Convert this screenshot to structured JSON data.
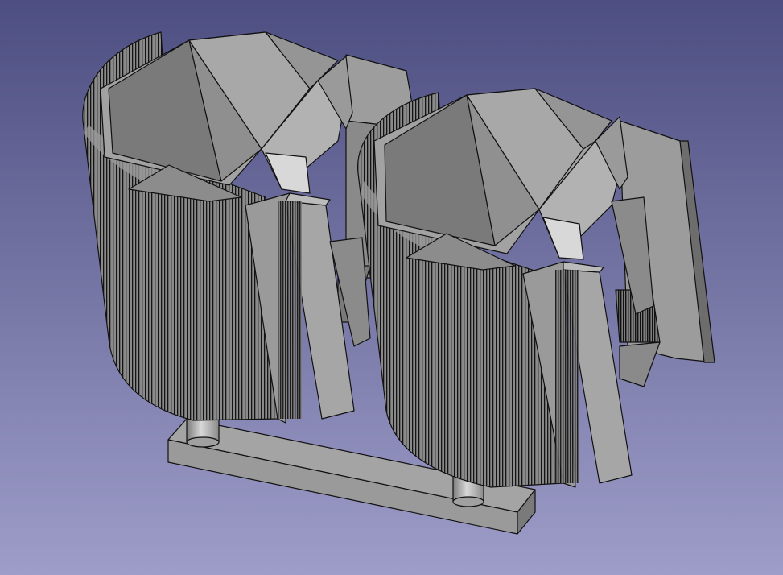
{
  "viewer": {
    "background_top": "#4e4f82",
    "background_bottom": "#9d9cc8",
    "face_light": "#a8a8a8",
    "face_mid": "#8d8d8d",
    "face_dark": "#6f6f6f",
    "edge_color": "#111111"
  },
  "model": {
    "parts": [
      "base-plate",
      "left-pin",
      "right-pin",
      "left-cup-body",
      "right-cup-body"
    ]
  }
}
